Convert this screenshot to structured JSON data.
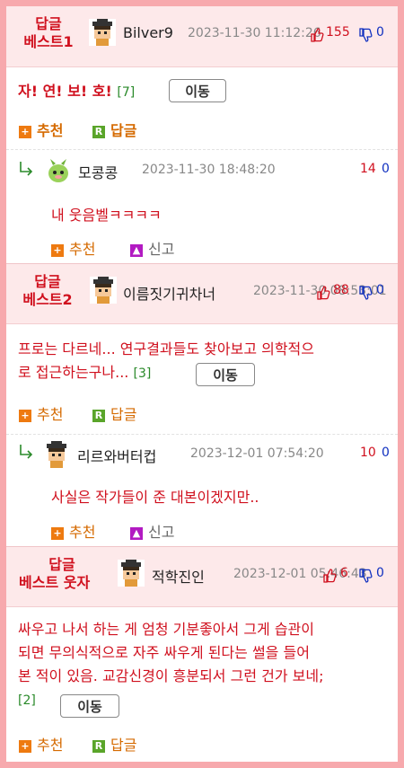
{
  "labels": {
    "recommend": "추천",
    "reply": "답글",
    "report": "신고",
    "move": "이동"
  },
  "best1": {
    "label_line1": "답글",
    "label_line2": "베스트1",
    "nick": "Bilver9",
    "date": "2023-11-30 11:12:26",
    "up": "155",
    "down": "0",
    "title": "자! 연! 보! 호!",
    "count": "[7]"
  },
  "reply1": {
    "nick": "모콩콩",
    "date": "2023-11-30 18:48:20",
    "up": "14",
    "down": "0",
    "text": "내 웃음벨ㅋㅋㅋㅋ"
  },
  "best2": {
    "label_line1": "답글",
    "label_line2": "베스트2",
    "nick": "이름짓기귀차너",
    "date": "2023-11-30 08:53:01",
    "up": "88",
    "down": "0",
    "title_line1": "프로는 다르네... 연구결과들도 찾아보고 의학적으",
    "title_line2": "로 접근하는구나...",
    "count": "[3]"
  },
  "reply2": {
    "nick": "리르와버터컵",
    "date": "2023-12-01 07:54:20",
    "up": "10",
    "down": "0",
    "text": "사실은 작가들이 준 대본이겠지만.."
  },
  "best3": {
    "label_line1": "답글",
    "label_line2": "베스트 웃자",
    "nick": "적학진인",
    "date": "2023-12-01 05:46:43",
    "up": "6",
    "down": "0",
    "title_line1": "싸우고 나서 하는 게 엄청 기분좋아서 그게 습관이",
    "title_line2": "되면 무의식적으로 자주 싸우게 된다는 썰을 들어",
    "title_line3": "본 적이 있음. 교감신경이 흥분되서 그런 건가 보네;",
    "count": "[2]"
  },
  "colors": {
    "accent_red": "#d0101e",
    "frame_pink": "#f7a9ad",
    "header_bg": "#fde9ea",
    "reco_orange": "#ee7a10",
    "reply_green": "#5aa52a"
  }
}
